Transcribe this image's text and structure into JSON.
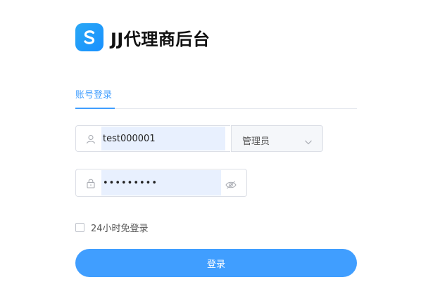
{
  "brand": {
    "title": "JJ代理商后台",
    "logo_icon": "s-logo-icon",
    "logo_color": "#1890ff"
  },
  "tabs": [
    {
      "label": "账号登录",
      "active": true
    }
  ],
  "username": {
    "value": "test000001",
    "icon": "user-icon"
  },
  "role_select": {
    "selected": "管理员",
    "icon": "chevron-down-icon"
  },
  "password": {
    "value": "•••••••••",
    "prefix_icon": "lock-icon",
    "suffix_icon": "eye-icon"
  },
  "remember": {
    "label": "24小时免登录",
    "checked": false
  },
  "submit": {
    "label": "登录"
  },
  "colors": {
    "primary": "#409eff",
    "autofill_bg": "#e8f0fe",
    "border": "#dcdfe6"
  }
}
